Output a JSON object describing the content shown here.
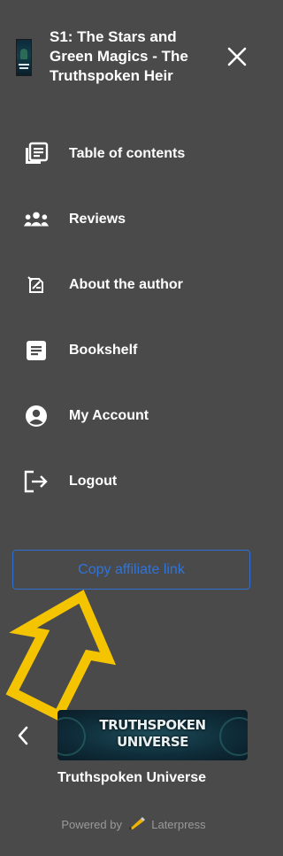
{
  "header": {
    "book_title": "S1: The Stars and Green Magics - The Truthspoken Heir",
    "close_icon": "close-icon"
  },
  "menu": {
    "items": [
      {
        "label": "Table of contents",
        "icon": "toc-icon"
      },
      {
        "label": "Reviews",
        "icon": "people-icon"
      },
      {
        "label": "About the author",
        "icon": "author-icon"
      },
      {
        "label": "Bookshelf",
        "icon": "bookshelf-icon"
      },
      {
        "label": "My Account",
        "icon": "account-icon"
      },
      {
        "label": "Logout",
        "icon": "logout-icon"
      }
    ]
  },
  "affiliate": {
    "label": "Copy affiliate link"
  },
  "series": {
    "banner_line1": "TRUTHSPOKEN",
    "banner_line2": "UNIVERSE",
    "title": "Truthspoken Universe"
  },
  "footer": {
    "powered_prefix": "Powered by",
    "brand": "Laterpress"
  },
  "colors": {
    "background": "#4a4a4a",
    "affiliate_blue": "#2f74d8",
    "annotation_arrow": "#f5c400"
  }
}
